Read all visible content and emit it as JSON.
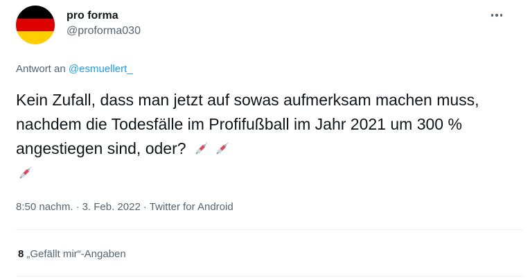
{
  "author": {
    "display_name": "pro forma",
    "handle": "@proforma030",
    "avatar_flag_colors": [
      "#000000",
      "#dd0000",
      "#ffce00"
    ]
  },
  "reply": {
    "prefix": "Antwort an",
    "mention": "@esmuellert_"
  },
  "tweet": {
    "text": "Kein Zufall, dass man jetzt auf sowas aufmerksam machen muss, nachdem die Todesfälle im Profifußball im Jahr 2021 um 300 % angestiegen sind, oder?",
    "emojis": [
      "syringe-icon",
      "syringe-icon",
      "syringe-icon"
    ]
  },
  "meta": {
    "time": "8:50 nachm.",
    "date": "3. Feb. 2022",
    "source": "Twitter for Android"
  },
  "likes": {
    "count": "8",
    "label": "„Gefällt mir“-Angaben"
  },
  "colors": {
    "text": "#0f1419",
    "secondary": "#536471",
    "accent": "#1d9bf0",
    "divider": "#eff3f4"
  }
}
